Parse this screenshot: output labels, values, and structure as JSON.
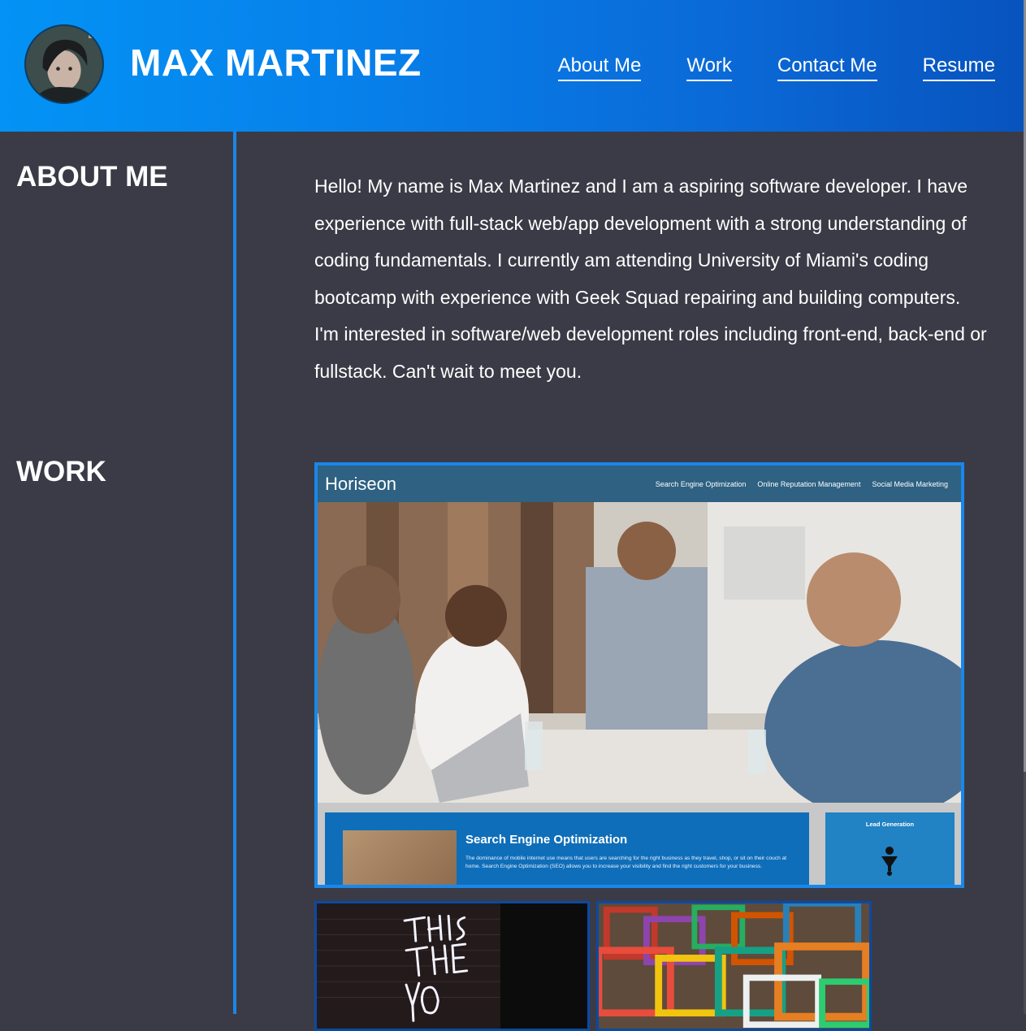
{
  "header": {
    "name": "MAX MARTINEZ",
    "avatar_icon": "profile-photo-icon",
    "nav": [
      {
        "label": "About Me"
      },
      {
        "label": "Work"
      },
      {
        "label": "Contact Me"
      },
      {
        "label": "Resume"
      }
    ]
  },
  "sections": {
    "about_heading": "ABOUT ME",
    "about_text": "Hello! My name is Max Martinez and I am a aspiring software developer. I have experience with full-stack web/app development with a strong understanding of coding fundamentals. I currently am attending University of Miami's coding bootcamp with experience with Geek Squad repairing and building computers. I'm interested in software/web development roles including front-end, back-end or fullstack. Can't wait to meet you.",
    "work_heading": "WORK"
  },
  "projects": {
    "featured": {
      "site_logo": "Horiseon",
      "site_nav": [
        "Search Engine Optimization",
        "Online Reputation Management",
        "Social Media Marketing"
      ],
      "card_title": "Search Engine Optimization",
      "card_text": "The dominance of mobile internet use means that users are searching for the right business as they travel, shop, or sit on their couch at home. Search Engine Optimization (SEO) allows you to increase your visibility and find the right customers for your business.",
      "side_title": "Lead Generation"
    },
    "thumbs": [
      {
        "icon": "neon-sign-photo"
      },
      {
        "icon": "picture-frames-photo"
      }
    ]
  },
  "colors": {
    "header_start": "#0393f5",
    "header_end": "#0853be",
    "body_bg": "#3a3b46",
    "accent": "#1a87ea"
  }
}
